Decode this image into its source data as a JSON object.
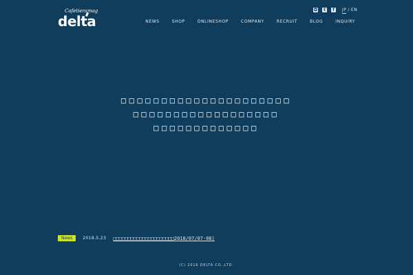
{
  "brand": {
    "script": "Cafetieramag",
    "word": "delta"
  },
  "social": {
    "instagram": "◘",
    "twitter": "t",
    "facebook": "f"
  },
  "lang": {
    "jp": "JP",
    "sep": "/",
    "en": "EN"
  },
  "nav": {
    "items": [
      "NEWS",
      "SHOP",
      "ONLINESHOP",
      "COMPANY",
      "RECRUIT",
      "BLOG",
      "INQUIRY"
    ]
  },
  "hero": {
    "line1": "□□□□□□□□□□□□□□□□□□□□□",
    "line2": "□□□□□□□□□□□□□□□□□□",
    "line3": "□□□□□□□□□□□□□"
  },
  "news": {
    "badge": "News",
    "date": "2018.5.23",
    "title": "□□□□□□□□□□□□□□□□□□□□□2018/07/07-08)"
  },
  "footer": {
    "copyright": "(C) 2016 DELTA  CO.,LTD."
  }
}
